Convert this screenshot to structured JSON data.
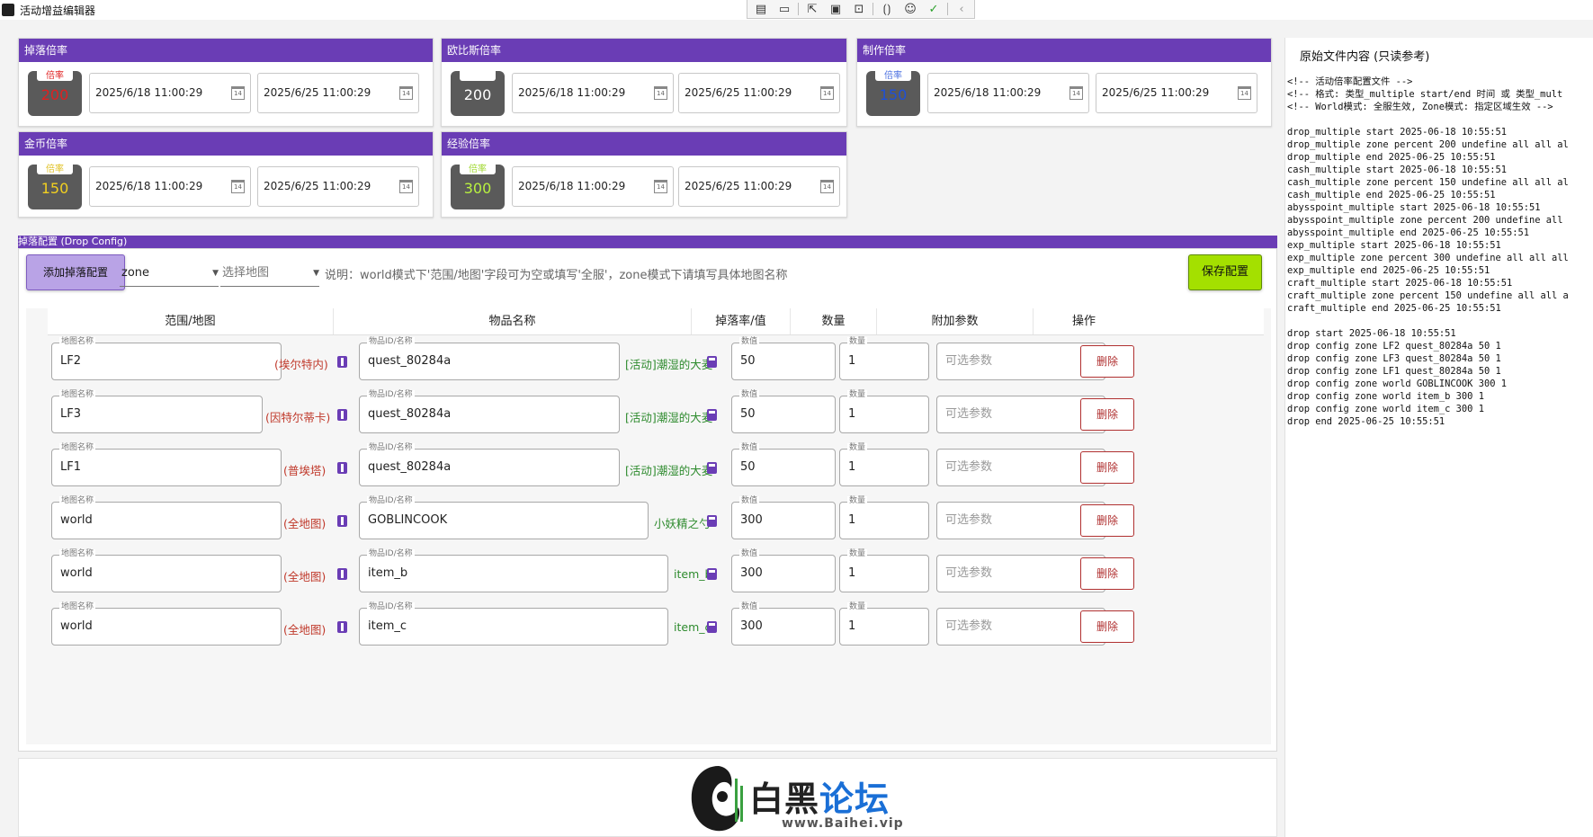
{
  "app": {
    "title": "活动增益编辑器"
  },
  "debug_toolbar": {
    "icons": [
      "live-tree-icon",
      "record-icon",
      "select-element-icon",
      "layout-adorner-icon",
      "track-focus-icon",
      "binding-failures-icon",
      "accessibility-icon",
      "check-icon",
      "collapse-icon"
    ]
  },
  "rate_cards": [
    {
      "title": "掉落倍率",
      "badge_tag": "倍率",
      "value": "200",
      "value_color": "#e02020",
      "tag_color": "#e02020",
      "start": "2025/6/18 11:00:29",
      "end": "2025/6/25 11:00:29"
    },
    {
      "title": "欧比斯倍率",
      "badge_tag": "",
      "value": "200",
      "value_color": "#ffffff",
      "tag_color": "#ffffff",
      "start": "2025/6/18 11:00:29",
      "end": "2025/6/25 11:00:29"
    },
    {
      "title": "制作倍率",
      "badge_tag": "倍率",
      "value": "150",
      "value_color": "#1e50d8",
      "tag_color": "#4a6fe0",
      "start": "2025/6/18 11:00:29",
      "end": "2025/6/25 11:00:29"
    },
    {
      "title": "金币倍率",
      "badge_tag": "倍率",
      "value": "150",
      "value_color": "#f2d020",
      "tag_color": "#e0c020",
      "start": "2025/6/18 11:00:29",
      "end": "2025/6/25 11:00:29"
    },
    {
      "title": "经验倍率",
      "badge_tag": "倍率",
      "value": "300",
      "value_color": "#b8f040",
      "tag_color": "#a0d830",
      "start": "2025/6/18 11:00:29",
      "end": "2025/6/25 11:00:29"
    }
  ],
  "drop": {
    "section_title": "掉落配置 (Drop Config)",
    "add_button": "添加掉落配置",
    "mode_value": "zone",
    "map_placeholder": "选择地图",
    "hint": "说明：world模式下'范围/地图'字段可为空或填写'全服'，zone模式下请填写具体地图名称",
    "save_button": "保存配置",
    "columns": [
      "范围/地图",
      "物品名称",
      "掉落率/值",
      "数量",
      "附加参数",
      "操作"
    ],
    "labels": {
      "map": "地图名称",
      "item": "物品ID/名称",
      "value": "数值",
      "qty": "数量"
    },
    "extra_placeholder": "可选参数",
    "delete_label": "删除",
    "rows": [
      {
        "map": "LF2",
        "map_note": "(埃尔特内)",
        "item": "quest_80284a",
        "item_note": "[活动]潮湿的大麦",
        "value": "50",
        "qty": "1"
      },
      {
        "map": "LF3",
        "map_note": "(因特尔蒂卡)",
        "item": "quest_80284a",
        "item_note": "[活动]潮湿的大麦",
        "value": "50",
        "qty": "1"
      },
      {
        "map": "LF1",
        "map_note": "(普埃塔)",
        "item": "quest_80284a",
        "item_note": "[活动]潮湿的大麦",
        "value": "50",
        "qty": "1"
      },
      {
        "map": "world",
        "map_note": "(全地图)",
        "item": "GOBLINCOOK",
        "item_note": "小妖精之勺",
        "value": "300",
        "qty": "1"
      },
      {
        "map": "world",
        "map_note": "(全地图)",
        "item": "item_b",
        "item_note": "item_b",
        "value": "300",
        "qty": "1"
      },
      {
        "map": "world",
        "map_note": "(全地图)",
        "item": "item_c",
        "item_note": "item_c",
        "value": "300",
        "qty": "1"
      }
    ]
  },
  "logo": {
    "text_a": "白黑",
    "text_b": "论坛",
    "url": "www.Baihei.vip"
  },
  "side": {
    "title": "原始文件内容 (只读参考)",
    "lines": [
      "<!-- 活动倍率配置文件 -->",
      "<!-- 格式: 类型_multiple start/end 时间 或 类型_mult",
      "<!-- World模式: 全服生效, Zone模式: 指定区域生效 -->",
      "",
      "drop_multiple start 2025-06-18 10:55:51",
      "drop_multiple zone percent 200 undefine all all al",
      "drop_multiple end 2025-06-25 10:55:51",
      "cash_multiple start 2025-06-18 10:55:51",
      "cash_multiple zone percent 150 undefine all all al",
      "cash_multiple end 2025-06-25 10:55:51",
      "abysspoint_multiple start 2025-06-18 10:55:51",
      "abysspoint_multiple zone percent 200 undefine all",
      "abysspoint_multiple end 2025-06-25 10:55:51",
      "exp_multiple start 2025-06-18 10:55:51",
      "exp_multiple zone percent 300 undefine all all all",
      "exp_multiple end 2025-06-25 10:55:51",
      "craft_multiple start 2025-06-18 10:55:51",
      "craft_multiple zone percent 150 undefine all all a",
      "craft_multiple end 2025-06-25 10:55:51",
      "",
      "drop start 2025-06-18 10:55:51",
      "drop config zone LF2 quest_80284a 50 1",
      "drop config zone LF3 quest_80284a 50 1",
      "drop config zone LF1 quest_80284a 50 1",
      "drop config zone world GOBLINCOOK 300 1",
      "drop config zone world item_b 300 1",
      "drop config zone world item_c 300 1",
      "drop end 2025-06-25 10:55:51"
    ]
  }
}
